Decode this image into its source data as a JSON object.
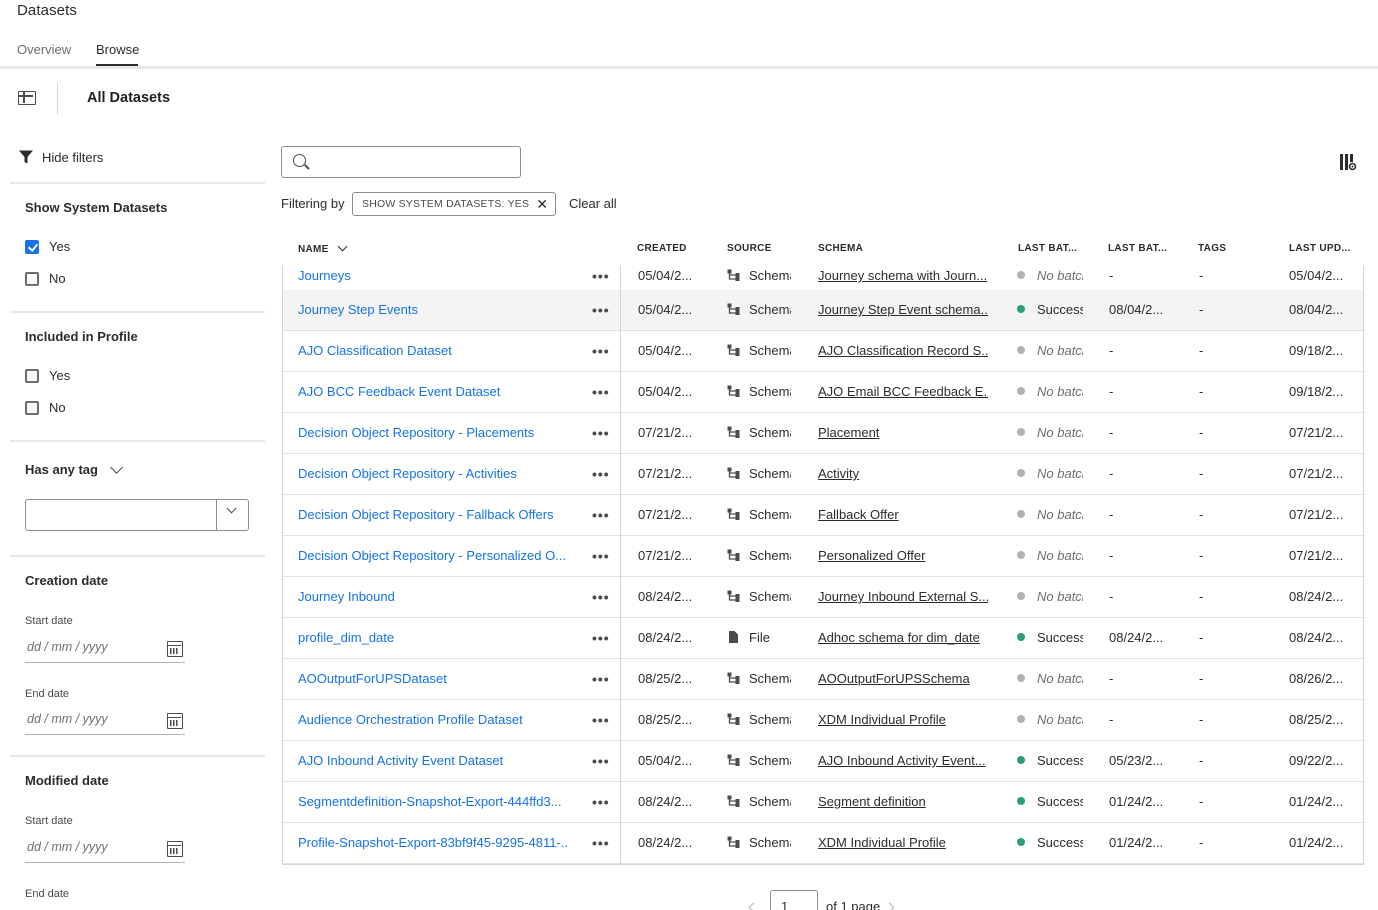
{
  "app": {
    "title": "Datasets"
  },
  "tabs": [
    {
      "label": "Overview"
    },
    {
      "label": "Browse"
    }
  ],
  "toolbar": {
    "title": "All Datasets"
  },
  "sidebar": {
    "hide_filters": "Hide filters",
    "system": {
      "heading": "Show System Datasets",
      "yes": "Yes",
      "no": "No",
      "yes_checked": true
    },
    "profile": {
      "heading": "Included in Profile",
      "yes": "Yes",
      "no": "No"
    },
    "tag": {
      "heading": "Has any tag"
    },
    "creation": {
      "heading": "Creation date",
      "start_label": "Start date",
      "end_label": "End date",
      "placeholder": "dd / mm / yyyy"
    },
    "modified": {
      "heading": "Modified date",
      "start_label": "Start date",
      "end_label": "End date",
      "placeholder": "dd / mm / yyyy"
    }
  },
  "filter_bar": {
    "filtering_by": "Filtering by",
    "chip": "SHOW SYSTEM DATASETS: YES",
    "clear_all": "Clear all"
  },
  "table": {
    "headers": {
      "name": "NAME",
      "created": "CREATED",
      "source": "SOURCE",
      "schema": "SCHEMA",
      "last_batch_status": "LAST BAT...",
      "last_batch_date": "LAST BAT...",
      "tags": "TAGS",
      "last_updated": "LAST UPD..."
    },
    "rows": [
      {
        "name": "Journeys",
        "created": "05/04/2...",
        "source": "Schema",
        "schema": "Journey schema with Journ...",
        "status": "No batch",
        "status_color": "#b3b3b3",
        "last_batch": "-",
        "tags": "-",
        "updated": "05/04/2..."
      },
      {
        "name": "Journey Step Events",
        "created": "05/04/2...",
        "source": "Schema",
        "schema": "Journey Step Event schema...",
        "status": "Success",
        "status_color": "#2d9d78",
        "last_batch": "08/04/2...",
        "tags": "-",
        "updated": "08/04/2..."
      },
      {
        "name": "AJO Classification Dataset",
        "created": "05/04/2...",
        "source": "Schema",
        "schema": "AJO Classification Record S...",
        "status": "No batch",
        "status_color": "#b3b3b3",
        "last_batch": "-",
        "tags": "-",
        "updated": "09/18/2..."
      },
      {
        "name": "AJO BCC Feedback Event Dataset",
        "created": "05/04/2...",
        "source": "Schema",
        "schema": "AJO Email BCC Feedback E...",
        "status": "No batch",
        "status_color": "#b3b3b3",
        "last_batch": "-",
        "tags": "-",
        "updated": "09/18/2..."
      },
      {
        "name": "Decision Object Repository - Placements",
        "created": "07/21/2...",
        "source": "Schema",
        "schema": "Placement",
        "status": "No batch",
        "status_color": "#b3b3b3",
        "last_batch": "-",
        "tags": "-",
        "updated": "07/21/2..."
      },
      {
        "name": "Decision Object Repository - Activities",
        "created": "07/21/2...",
        "source": "Schema",
        "schema": "Activity",
        "status": "No batch",
        "status_color": "#b3b3b3",
        "last_batch": "-",
        "tags": "-",
        "updated": "07/21/2..."
      },
      {
        "name": "Decision Object Repository - Fallback Offers",
        "created": "07/21/2...",
        "source": "Schema",
        "schema": "Fallback Offer",
        "status": "No batch",
        "status_color": "#b3b3b3",
        "last_batch": "-",
        "tags": "-",
        "updated": "07/21/2..."
      },
      {
        "name": "Decision Object Repository - Personalized O...",
        "created": "07/21/2...",
        "source": "Schema",
        "schema": "Personalized Offer",
        "status": "No batch",
        "status_color": "#b3b3b3",
        "last_batch": "-",
        "tags": "-",
        "updated": "07/21/2..."
      },
      {
        "name": "Journey Inbound",
        "created": "08/24/2...",
        "source": "Schema",
        "schema": "Journey Inbound External S...",
        "status": "No batch",
        "status_color": "#b3b3b3",
        "last_batch": "-",
        "tags": "-",
        "updated": "08/24/2..."
      },
      {
        "name": "profile_dim_date",
        "created": "08/24/2...",
        "source": "File",
        "schema": "Adhoc schema for dim_date",
        "status": "Success",
        "status_color": "#2d9d78",
        "last_batch": "08/24/2...",
        "tags": "-",
        "updated": "08/24/2..."
      },
      {
        "name": "AOOutputForUPSDataset",
        "created": "08/25/2...",
        "source": "Schema",
        "schema": "AOOutputForUPSSchema",
        "status": "No batch",
        "status_color": "#b3b3b3",
        "last_batch": "-",
        "tags": "-",
        "updated": "08/26/2..."
      },
      {
        "name": "Audience Orchestration Profile Dataset",
        "created": "08/25/2...",
        "source": "Schema",
        "schema": "XDM Individual Profile",
        "status": "No batch",
        "status_color": "#b3b3b3",
        "last_batch": "-",
        "tags": "-",
        "updated": "08/25/2..."
      },
      {
        "name": "AJO Inbound Activity Event Dataset",
        "created": "05/04/2...",
        "source": "Schema",
        "schema": "AJO Inbound Activity Event...",
        "status": "Success",
        "status_color": "#2d9d78",
        "last_batch": "05/23/2...",
        "tags": "-",
        "updated": "09/22/2..."
      },
      {
        "name": "Segmentdefinition-Snapshot-Export-444ffd3...",
        "created": "08/24/2...",
        "source": "Schema",
        "schema": "Segment definition",
        "status": "Success",
        "status_color": "#2d9d78",
        "last_batch": "01/24/2...",
        "tags": "-",
        "updated": "01/24/2..."
      },
      {
        "name": "Profile-Snapshot-Export-83bf9f45-9295-4811-...",
        "created": "08/24/2...",
        "source": "Schema",
        "schema": "XDM Individual Profile",
        "status": "Success",
        "status_color": "#2d9d78",
        "last_batch": "01/24/2...",
        "tags": "-",
        "updated": "01/24/2..."
      }
    ]
  },
  "pagination": {
    "page": "1",
    "of_label": "of 1 page"
  },
  "colors": {
    "link": "#1473e6",
    "success": "#2d9d78",
    "no_batch": "#b3b3b3",
    "checkbox": "#1473e6"
  }
}
